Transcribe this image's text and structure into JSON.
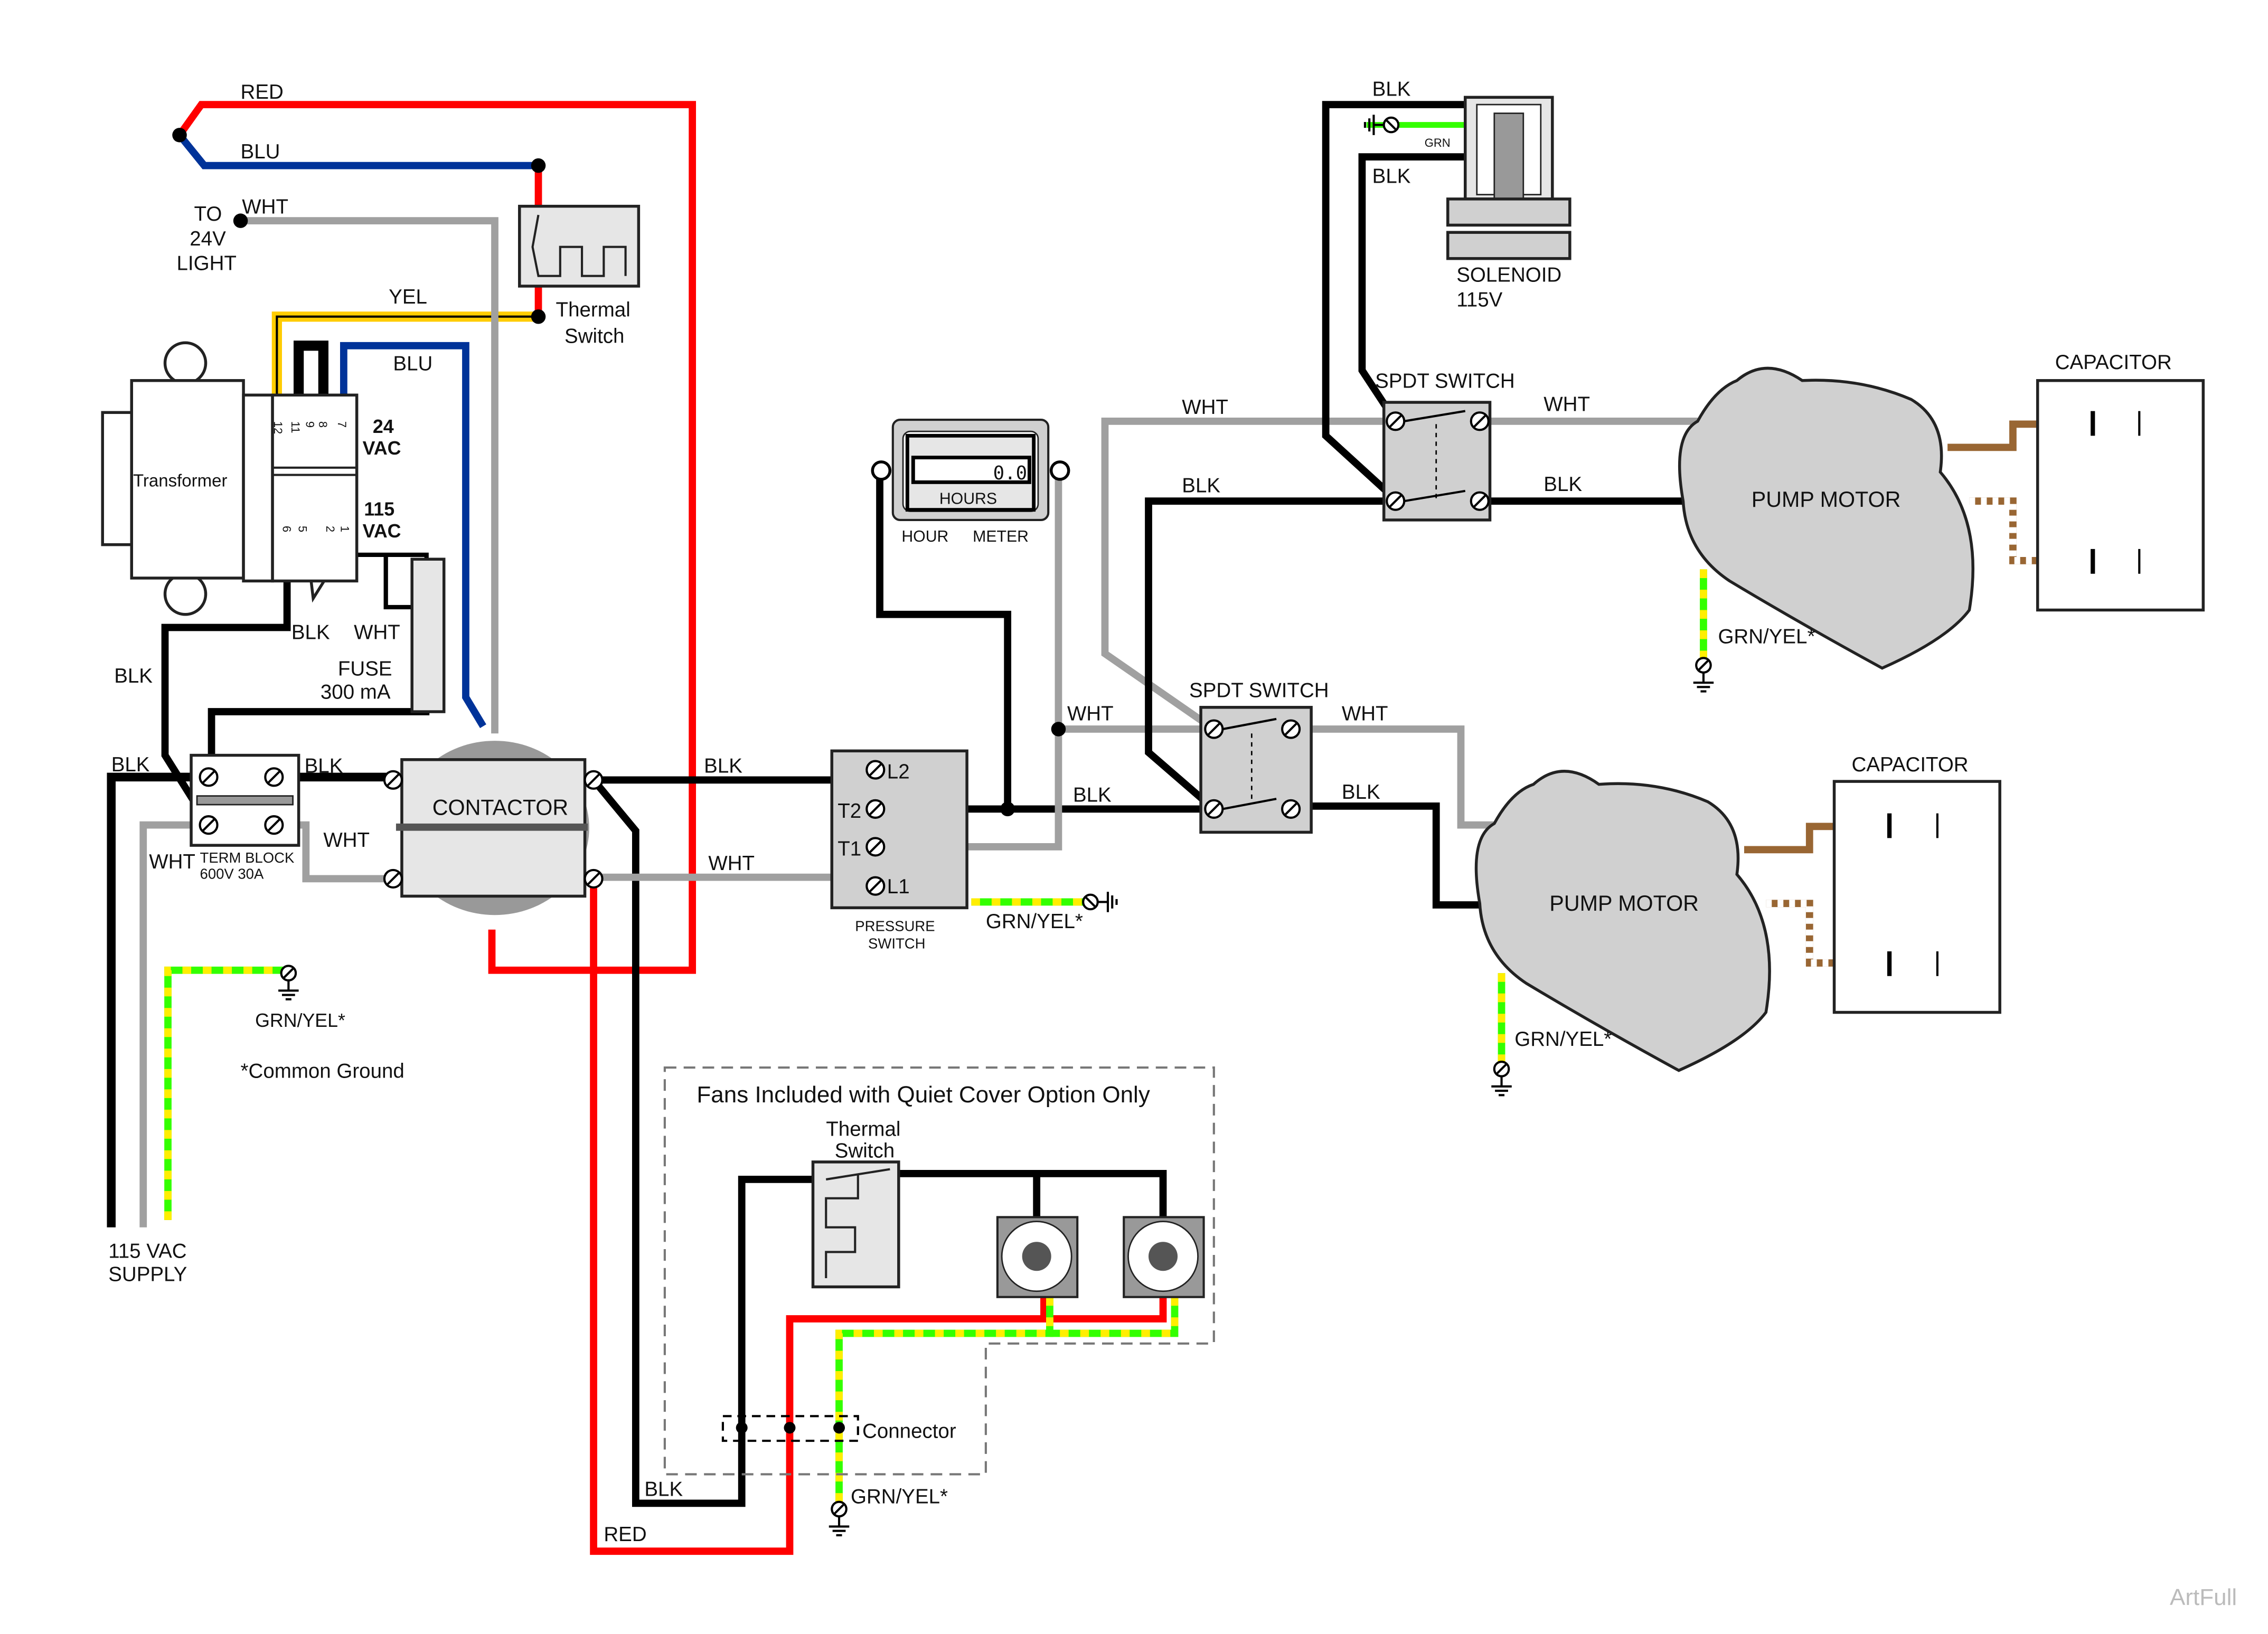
{
  "colors": {
    "red": "#ff0000",
    "blue": "#003399",
    "white_wire": "#a0a0a0",
    "black": "#000000",
    "yellow": "#ffcc00",
    "green": "#33ff00",
    "brown": "#996633",
    "component_fill": "#d0d0d0"
  },
  "labels": {
    "red_top": "RED",
    "blu_top": "BLU",
    "wht_top": "WHT",
    "to_light": [
      "TO",
      "24V",
      "LIGHT"
    ],
    "yel": "YEL",
    "thermal_switch": [
      "Thermal",
      "Switch"
    ],
    "blu_xfmr": "BLU",
    "transformer": "Transformer",
    "vac24": [
      "24",
      "VAC"
    ],
    "vac115": [
      "115",
      "VAC"
    ],
    "pins_top": [
      "12",
      "11",
      "9",
      "8",
      "7"
    ],
    "pins_bottom": [
      "6",
      "5",
      "2",
      "1"
    ],
    "blk_xfmr": "BLK",
    "wht_xfmr": "WHT",
    "fuse": [
      "FUSE",
      "300 mA"
    ],
    "blk_left": "BLK",
    "blk_supply": "BLK",
    "blk_tb": "BLK",
    "wht_tb": "WHT",
    "wht_supply": "WHT",
    "term_block": [
      "TERM BLOCK",
      "600V 30A"
    ],
    "contactor": "CONTACTOR",
    "grn_yel_left": "GRN/YEL*",
    "common_ground": "*Common Ground",
    "supply": [
      "115 VAC",
      "SUPPLY"
    ],
    "blk_contactor": "BLK",
    "wht_contactor": "WHT",
    "pressure_terminals": [
      "L2",
      "T2",
      "T1",
      "L1"
    ],
    "pressure_switch": [
      "PRESSURE",
      "SWITCH"
    ],
    "grn_yel_ps": "GRN/YEL*",
    "hour_meter_display": "0.0",
    "hours": "HOURS",
    "hour_meter": [
      "HOUR",
      "METER"
    ],
    "wht_sw2_left": "WHT",
    "blk_sw2_left": "BLK",
    "spdt2": "SPDT SWITCH",
    "wht_sw2_right": "WHT",
    "blk_sw2_right": "BLK",
    "wht_sw1_left": "WHT",
    "blk_sw1_left": "BLK",
    "spdt1": "SPDT SWITCH",
    "wht_sw1_right": "WHT",
    "blk_sw1_right": "BLK",
    "blk_sol1": "BLK",
    "blk_sol2": "BLK",
    "grn_sol": "GRN",
    "solenoid": [
      "SOLENOID",
      "115V"
    ],
    "pump_motor1": "PUMP MOTOR",
    "pump_motor2": "PUMP MOTOR",
    "capacitor1": "CAPACITOR",
    "capacitor2": "CAPACITOR",
    "grn_yel_m1": "GRN/YEL*",
    "grn_yel_m2": "GRN/YEL*",
    "fans_title": "Fans Included with Quiet Cover Option Only",
    "fan_thermal": [
      "Thermal",
      "Switch"
    ],
    "connector": "Connector",
    "blk_fan": "BLK",
    "red_fan": "RED",
    "grn_yel_fan": "GRN/YEL*",
    "watermark": "ArtFull"
  }
}
